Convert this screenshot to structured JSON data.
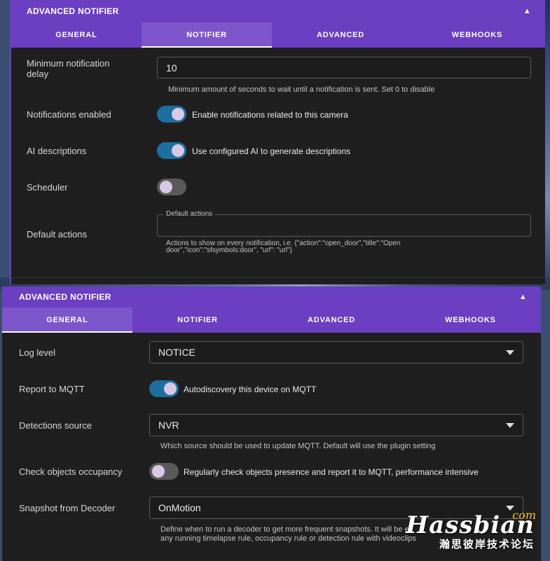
{
  "top_panel": {
    "title": "ADVANCED NOTIFIER",
    "tabs": [
      {
        "label": "GENERAL"
      },
      {
        "label": "NOTIFIER"
      },
      {
        "label": "ADVANCED"
      },
      {
        "label": "WEBHOOKS"
      }
    ],
    "active_tab": 1,
    "min_delay": {
      "label_line1": "Minimum notification",
      "label_line2": "delay",
      "value": "10",
      "hint": "Minimum amount of seconds to wait until a notification is sent. Set 0 to disable"
    },
    "notifications_enabled": {
      "label": "Notifications enabled",
      "toggle_on": true,
      "toggle_label": "Enable notifications related to this camera"
    },
    "ai_descriptions": {
      "label": "AI descriptions",
      "toggle_on": true,
      "toggle_label": "Use configured AI to generate descriptions"
    },
    "scheduler": {
      "label": "Scheduler",
      "toggle_on": false
    },
    "default_actions": {
      "label": "Default actions",
      "legend": "Default actions",
      "value": "",
      "hint_line1": "Actions to show on every notification, i.e. {\"action\":\"open_door\",\"title\":\"Open",
      "hint_line2": "door\",\"icon\":\"sfsymbols:door\", \"url\": \"url\"}"
    }
  },
  "bottom_panel": {
    "title": "ADVANCED NOTIFIER",
    "tabs": [
      {
        "label": "GENERAL"
      },
      {
        "label": "NOTIFIER"
      },
      {
        "label": "ADVANCED"
      },
      {
        "label": "WEBHOOKS"
      }
    ],
    "active_tab": 0,
    "log_level": {
      "label": "Log level",
      "value": "NOTICE"
    },
    "report_mqtt": {
      "label": "Report to MQTT",
      "toggle_on": true,
      "toggle_label": "Autodiscovery this device on MQTT"
    },
    "detections_source": {
      "label": "Detections source",
      "value": "NVR",
      "hint": "Which source should be used to update MQTT. Default will use the plugin setting"
    },
    "check_occupancy": {
      "label": "Check objects occupancy",
      "toggle_on": false,
      "toggle_label": "Regularly check objects presence and report it to MQTT, performance intensive"
    },
    "snapshot_decoder": {
      "label": "Snapshot from Decoder",
      "value": "OnMotion",
      "hint_line1": "Define when to run a decoder to get more frequent snapshots. It will be en",
      "hint_line2": "any running timelapse rule, occupancy rule or detection rule with videoclips"
    }
  },
  "watermark": {
    "main": "Hassbian",
    "com": "com",
    "sub": "瀚思彼岸技术论坛"
  },
  "colors": {
    "header_purple": "#6b3ec2",
    "toggle_on": "#1d6fa0",
    "panel_bg": "#1f1f1f"
  }
}
